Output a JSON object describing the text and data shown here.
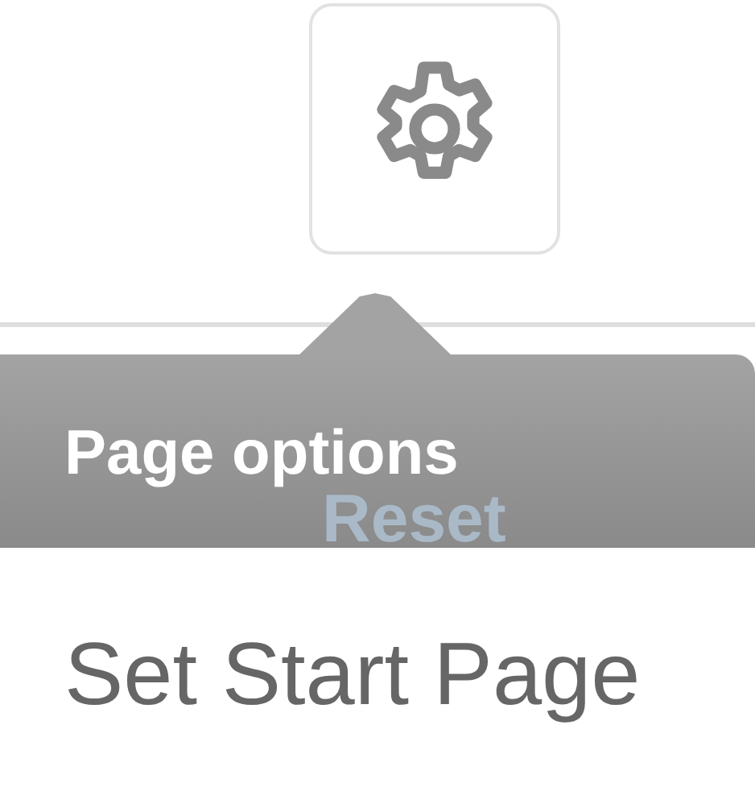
{
  "settings_button": {
    "label": "Page options"
  },
  "hidden_link": "Reset",
  "menu_item": "Set Start Page"
}
